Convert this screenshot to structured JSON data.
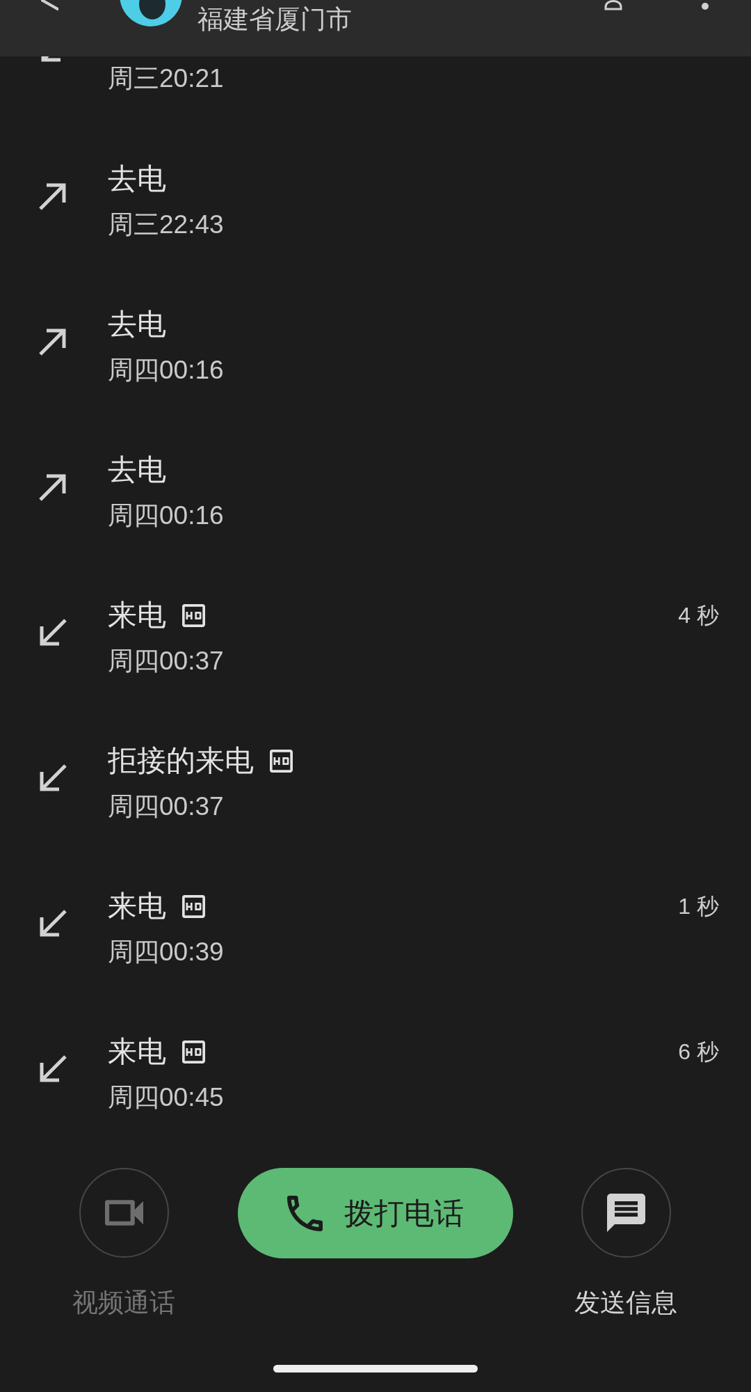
{
  "top_bar": {
    "subtitle": "福建省厦门市"
  },
  "calls": [
    {
      "kind": "incoming",
      "time": "周三20:21"
    },
    {
      "kind": "outgoing",
      "title": "去电",
      "hd": false,
      "time": "周三22:43"
    },
    {
      "kind": "outgoing",
      "title": "去电",
      "hd": false,
      "time": "周四00:16"
    },
    {
      "kind": "outgoing",
      "title": "去电",
      "hd": false,
      "time": "周四00:16"
    },
    {
      "kind": "incoming",
      "title": "来电",
      "hd": true,
      "duration": "4 秒",
      "time": "周四00:37"
    },
    {
      "kind": "incoming",
      "title": "拒接的来电",
      "hd": true,
      "time": "周四00:37"
    },
    {
      "kind": "incoming",
      "title": "来电",
      "hd": true,
      "duration": "1 秒",
      "time": "周四00:39"
    },
    {
      "kind": "incoming",
      "title": "来电",
      "hd": true,
      "duration": "6 秒",
      "time": "周四00:45"
    }
  ],
  "actions": [
    {
      "kind": "video",
      "label": "视频通话",
      "disabled": true
    },
    {
      "kind": "call",
      "label": "拨打电话"
    },
    {
      "kind": "message",
      "label": "发送信息",
      "disabled": false
    }
  ]
}
